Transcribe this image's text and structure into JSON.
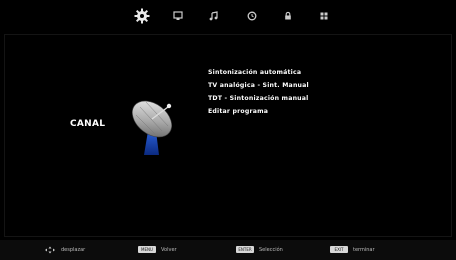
{
  "tabs": [
    {
      "name": "gear-icon",
      "label": "Configuración"
    },
    {
      "name": "monitor-icon",
      "label": "Imagen"
    },
    {
      "name": "music-note-icon",
      "label": "Sonido"
    },
    {
      "name": "clock-icon",
      "label": "Tiempo"
    },
    {
      "name": "lock-icon",
      "label": "Bloqueo"
    },
    {
      "name": "grid-icon",
      "label": "Ajustes"
    }
  ],
  "section": {
    "title": "CANAL",
    "icon": "satellite-dish-icon"
  },
  "menu": {
    "items": [
      "Sintonización automática",
      "TV analógica - Sint. Manual",
      "TDT - Sintonización manual",
      "Editar programa"
    ]
  },
  "footer": {
    "move_icon": "dpad-arrows-icon",
    "move_label": "desplazar",
    "back_key": "MENU",
    "back_label": "Volver",
    "select_key": "ENTER",
    "select_label": "Selección",
    "exit_key": "EXIT",
    "exit_label": "terminar"
  }
}
